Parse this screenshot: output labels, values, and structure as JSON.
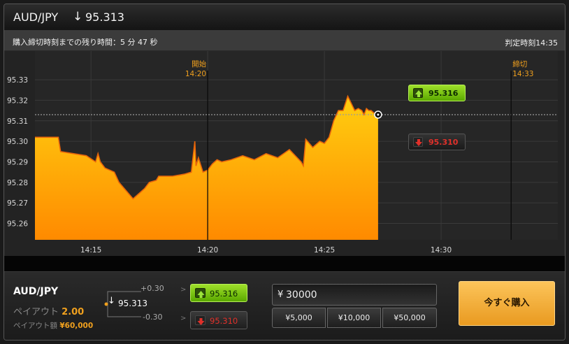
{
  "header": {
    "pair": "AUD/JPY",
    "direction_symbol": "↓",
    "price": "95.313"
  },
  "info_bar": {
    "time_remaining": "購入締切時刻までの残り時間：5 分 47 秒",
    "judgment_time": "判定時刻14:35"
  },
  "chart_data": {
    "type": "area",
    "title": "",
    "xlabel": "",
    "ylabel": "",
    "x_ticks": [
      "14:15",
      "14:20",
      "14:25",
      "14:30"
    ],
    "y_ticks": [
      "95.33",
      "95.32",
      "95.31",
      "95.30",
      "95.29",
      "95.28",
      "95.27",
      "95.26"
    ],
    "ylim": [
      95.252,
      95.344
    ],
    "xlim_minutes": [
      12.6,
      35.0
    ],
    "fill_color": "#f79a0e",
    "line_color": "#e8650a",
    "reference_price": 95.313,
    "markers": [
      {
        "label": "開始",
        "time": "14:20",
        "minute": 20.0
      },
      {
        "label": "締切",
        "time": "14:33",
        "minute": 33.0
      }
    ],
    "series": {
      "minute": [
        12.6,
        13.6,
        13.7,
        14.8,
        15.2,
        15.3,
        15.4,
        15.6,
        16.0,
        16.2,
        16.8,
        17.1,
        17.3,
        17.5,
        17.8,
        17.9,
        18.0,
        18.5,
        19.0,
        19.3,
        19.45,
        19.5,
        19.6,
        19.8,
        20.0,
        20.2,
        20.4,
        20.6,
        21.0,
        21.5,
        22.0,
        22.5,
        23.0,
        23.5,
        24.0,
        24.1,
        24.2,
        24.5,
        24.8,
        25.0,
        25.2,
        25.4,
        25.6,
        25.7,
        25.8,
        26.0,
        26.3,
        26.45,
        26.6,
        26.7,
        26.8,
        26.9,
        27.0,
        27.1,
        27.2,
        27.3
      ],
      "value": [
        95.302,
        95.302,
        95.295,
        95.293,
        95.29,
        95.294,
        95.29,
        95.287,
        95.285,
        95.28,
        95.272,
        95.275,
        95.277,
        95.28,
        95.281,
        95.283,
        95.283,
        95.283,
        95.284,
        95.285,
        95.3,
        95.288,
        95.292,
        95.285,
        95.286,
        95.289,
        95.291,
        95.29,
        95.291,
        95.293,
        95.291,
        95.294,
        95.292,
        95.296,
        95.29,
        95.288,
        95.301,
        95.297,
        95.3,
        95.299,
        95.302,
        95.31,
        95.315,
        95.315,
        95.315,
        95.322,
        95.315,
        95.316,
        95.315,
        95.313,
        95.316,
        95.315,
        95.315,
        95.314,
        95.313,
        95.313
      ]
    }
  },
  "tags": {
    "high_price": "95.316",
    "low_price": "95.310"
  },
  "panel": {
    "pair": "AUD/JPY",
    "payout_label": "ペイアウト",
    "payout_value": "2.00",
    "payout_amount_label": "ペイアウト額",
    "payout_amount_value": "¥60,000",
    "plus_offset": "+0.30",
    "minus_offset": "-0.30",
    "current_symbol": "↓",
    "current_price": "95.313",
    "arrow_gt": ">",
    "high_price": "95.316",
    "low_price": "95.310",
    "amount_symbol": "¥",
    "amount_value": "30000",
    "presets": [
      "¥5,000",
      "¥10,000",
      "¥50,000"
    ],
    "buy_label": "今すぐ購入"
  }
}
